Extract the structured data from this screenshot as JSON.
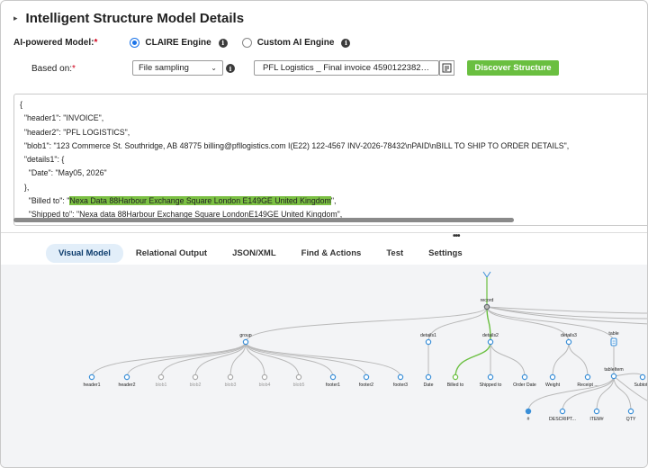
{
  "header": {
    "title": "Intelligent Structure Model Details"
  },
  "model": {
    "label": "AI-powered Model:",
    "options": [
      {
        "label": "CLAIRE Engine",
        "selected": true
      },
      {
        "label": "Custom AI Engine",
        "selected": false
      }
    ]
  },
  "based_on": {
    "label": "Based on:",
    "select_value": "File sampling",
    "file_value": "PFL Logistics _ Final invoice 4590122382726t2...",
    "discover_label": "Discover Structure"
  },
  "json_lines": [
    "{",
    "  \"header1\": \"INVOICE\",",
    "  \"header2\": \"PFL LOGISTICS\",",
    "  \"blob1\": \"123 Commerce St. Southridge, AB 48775 billing@pfllogistics.com I(E22) 122-4567 INV-2026-78432\\nPAID\\nBILL TO SHIP TO ORDER DETAILS\",",
    "  \"details1\": {",
    "    \"Date\": \"May05, 2026\"",
    "  },",
    "  \"details2\": {",
    "    \"Billed to\": \"",
    "    \"Shipped to\": \"Nexa data 88Harbour Exchange Square LondonE149GE United Kingdom\","
  ],
  "billed_value": "Nexa Data 88Harbour Exchange Square London E149GE United Kingdom",
  "billed_suffix": "\",",
  "tabs": [
    "Visual Model",
    "Relational Output",
    "JSON/XML",
    "Find & Actions",
    "Test",
    "Settings"
  ],
  "active_tab": "Visual Model",
  "tree": {
    "root": "record",
    "group": "group",
    "group_children": [
      "header1",
      "header2",
      "blob1",
      "blob2",
      "blob3",
      "blob4",
      "blob5",
      "footer1",
      "footer2",
      "footer3"
    ],
    "greyed": [
      "blob1",
      "blob2",
      "blob3",
      "blob4",
      "blob5"
    ],
    "details1": "details1",
    "details1_children": [
      "Date"
    ],
    "details2": "details2",
    "details2_children": [
      "Billed to",
      "Shipped to",
      "Order Date"
    ],
    "details3": "details3",
    "details3_children": [
      "Weight",
      "Receipt ..."
    ],
    "table": "table",
    "tableitem": "tableItem",
    "tableitem_children": [
      "#",
      "DESCRIPT...",
      "ITEM#",
      "QTY"
    ],
    "subtotal": "Subtotal"
  },
  "colors": {
    "accent": "#1a73e8",
    "green": "#6abf40",
    "highlight": "#7bc043",
    "node": "#3a8fd8"
  }
}
